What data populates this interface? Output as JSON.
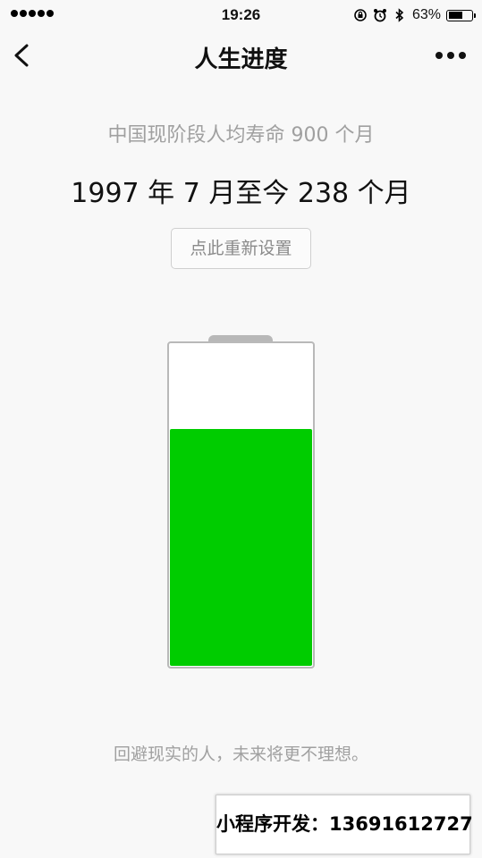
{
  "status_bar": {
    "time": "19:26",
    "battery_percent": "63%",
    "battery_level": 0.63,
    "icons": [
      "signal-dots-icon",
      "rotation-lock-icon",
      "alarm-icon",
      "bluetooth-icon",
      "battery-icon"
    ]
  },
  "nav": {
    "title": "人生进度",
    "back_icon": "chevron-left-icon",
    "more_icon": "more-dots-icon"
  },
  "main": {
    "life_expectancy_text": "中国现阶段人均寿命 900 个月",
    "months_elapsed_text": "1997 年 7 月至今 238 个月",
    "reset_button_label": "点此重新设置",
    "quote": "回避现实的人，未来将更不理想。"
  },
  "progress": {
    "remaining_fraction": 0.7356,
    "fill_color": "#00cc00"
  },
  "watermark": {
    "text": "小程序开发：13691612727"
  }
}
